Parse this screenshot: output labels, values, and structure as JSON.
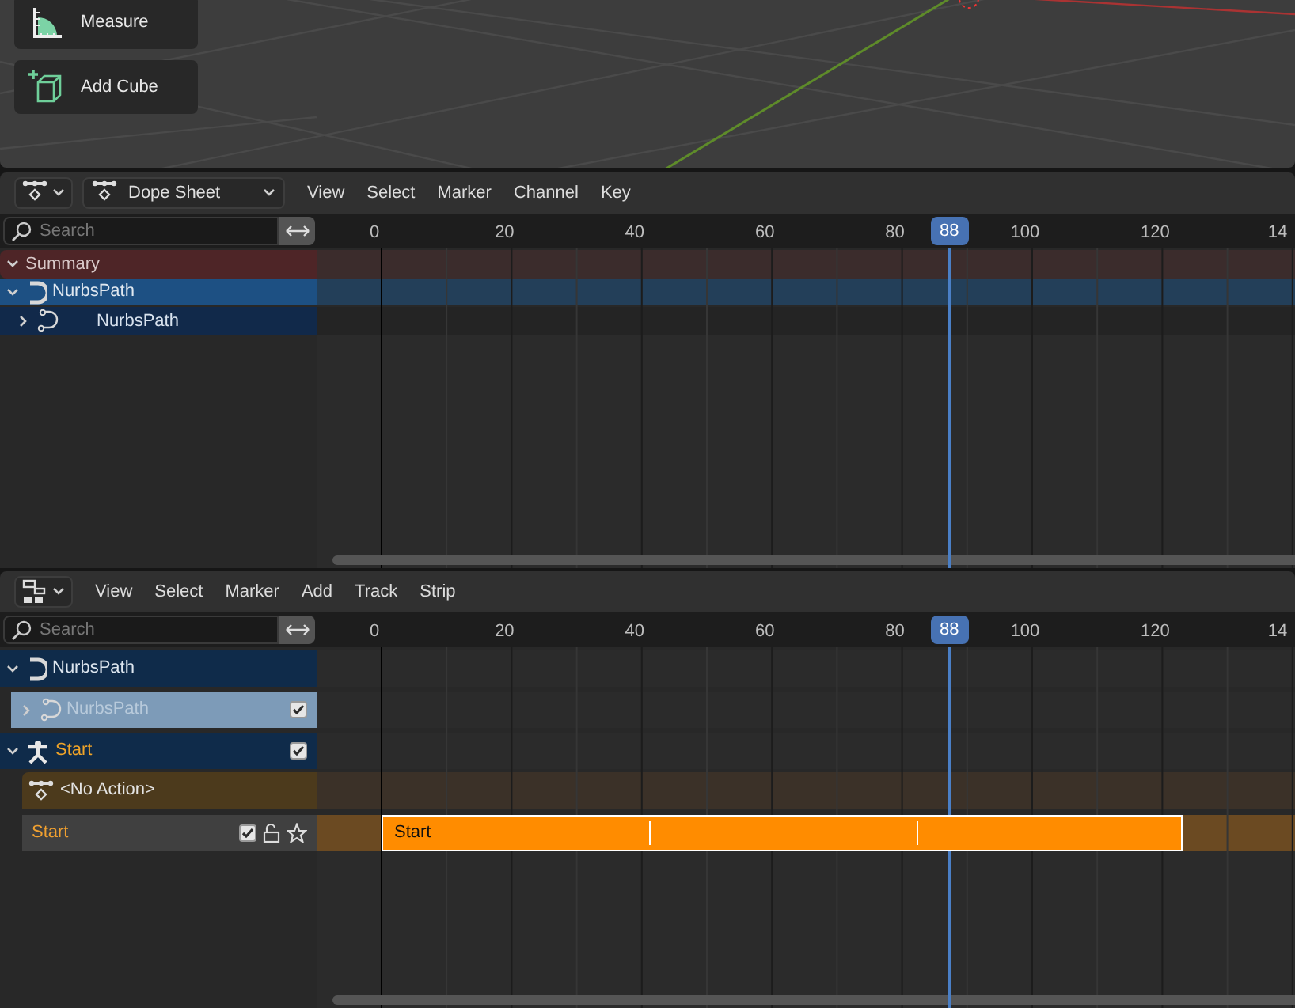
{
  "viewport": {
    "tools": [
      {
        "label": "Measure",
        "kind": "measure"
      },
      {
        "label": "Add Cube",
        "kind": "cube"
      }
    ]
  },
  "dope_sheet": {
    "editor": "Dope Sheet",
    "menu": [
      "View",
      "Select",
      "Marker",
      "Channel",
      "Key"
    ],
    "search": {
      "placeholder": "Search"
    },
    "ruler": [
      "0",
      "20",
      "40",
      "60",
      "80",
      "100",
      "120",
      "14"
    ],
    "current_frame": "88",
    "channels": [
      {
        "label": "Summary",
        "kind": "summary",
        "expanded": true
      },
      {
        "label": "NurbsPath",
        "kind": "object",
        "expanded": true
      },
      {
        "label": "NurbsPath",
        "kind": "data",
        "expanded": false
      }
    ]
  },
  "nla": {
    "menu": [
      "View",
      "Select",
      "Marker",
      "Add",
      "Track",
      "Strip"
    ],
    "search": {
      "placeholder": "Search"
    },
    "ruler": [
      "0",
      "20",
      "40",
      "60",
      "80",
      "100",
      "120",
      "14"
    ],
    "current_frame": "88",
    "tracks": [
      {
        "label": "NurbsPath",
        "kind": "object",
        "expanded": true
      },
      {
        "label": "NurbsPath",
        "kind": "data",
        "expanded": false,
        "checked": true
      },
      {
        "label": "Start",
        "kind": "armature",
        "expanded": true,
        "checked": true
      },
      {
        "label": "<No Action>",
        "kind": "action"
      },
      {
        "label": "Start",
        "kind": "track",
        "checked": true,
        "strip": "Start"
      }
    ]
  }
}
